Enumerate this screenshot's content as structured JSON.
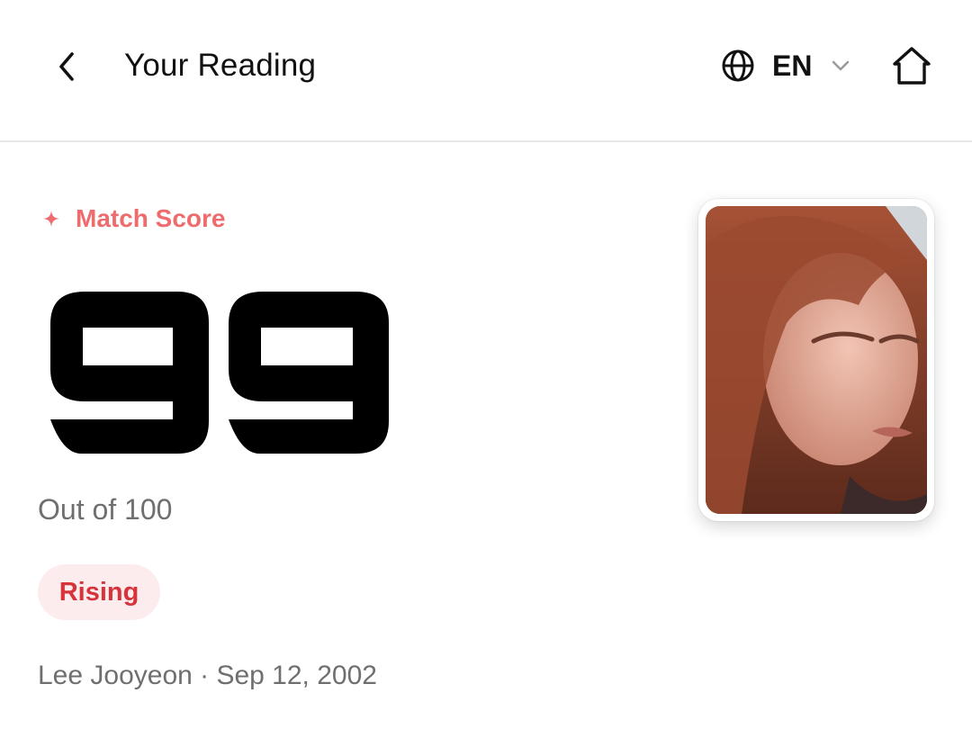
{
  "header": {
    "title": "Your Reading",
    "language": "EN"
  },
  "icons": {
    "back": "chevron-left-icon",
    "globe": "globe-icon",
    "dropdown": "chevron-down-icon",
    "home": "home-icon",
    "sparkle": "sparkle-icon"
  },
  "score": {
    "label": "Match Score",
    "value": "99",
    "out_of": "Out of 100",
    "status": "Rising"
  },
  "profile": {
    "meta": "Lee Jooyeon · Sep 12, 2002"
  },
  "colors": {
    "accent": "#ee6b6e",
    "badge_bg": "#fdecee",
    "badge_text": "#d6333b",
    "muted_text": "#6f6f6f"
  }
}
